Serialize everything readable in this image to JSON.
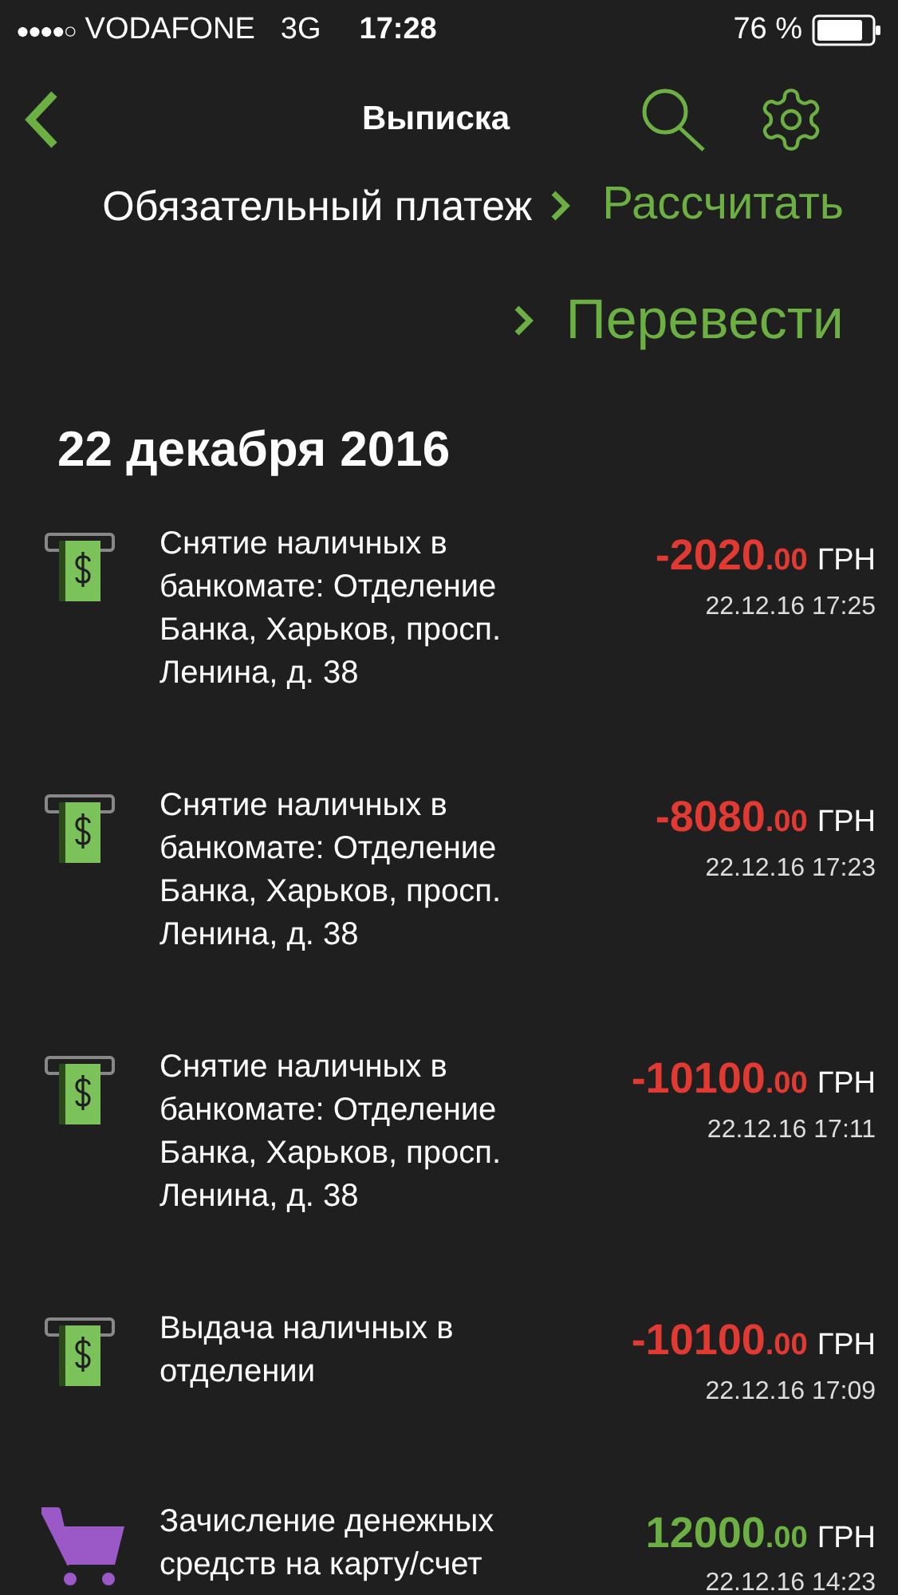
{
  "status_bar": {
    "signal_dots": "●●●●○",
    "carrier": "VODAFONE",
    "network": "3G",
    "time": "17:28",
    "battery": "76 %"
  },
  "nav": {
    "title": "Выписка"
  },
  "actions": {
    "label": "Обязательный платеж",
    "calculate": "Рассчитать",
    "transfer": "Перевести"
  },
  "date_header": "22 декабря 2016",
  "transactions": [
    {
      "kind": "atm",
      "credit": false,
      "description": "Снятие наличных в банкомате: Отделение Банка, Харьков, просп. Ленина, д. 38",
      "amount": "-2020",
      "cents": ".00",
      "currency": "ГРН",
      "datetime": "22.12.16 17:25"
    },
    {
      "kind": "atm",
      "credit": false,
      "description": "Снятие наличных в банкомате: Отделение Банка, Харьков, просп. Ленина, д. 38",
      "amount": "-8080",
      "cents": ".00",
      "currency": "ГРН",
      "datetime": "22.12.16 17:23"
    },
    {
      "kind": "atm",
      "credit": false,
      "description": "Снятие наличных в банкомате: Отделение Банка, Харьков, просп. Ленина, д. 38",
      "amount": "-10100",
      "cents": ".00",
      "currency": "ГРН",
      "datetime": "22.12.16 17:11"
    },
    {
      "kind": "atm",
      "credit": false,
      "description": "Выдача наличных в отделении",
      "amount": "-10100",
      "cents": ".00",
      "currency": "ГРН",
      "datetime": "22.12.16 17:09"
    },
    {
      "kind": "cart",
      "credit": true,
      "description": "Зачисление денежных средств на карту/счет",
      "amount": "12000",
      "cents": ".00",
      "currency": "ГРН",
      "datetime": "22.12.16 14:23"
    }
  ]
}
